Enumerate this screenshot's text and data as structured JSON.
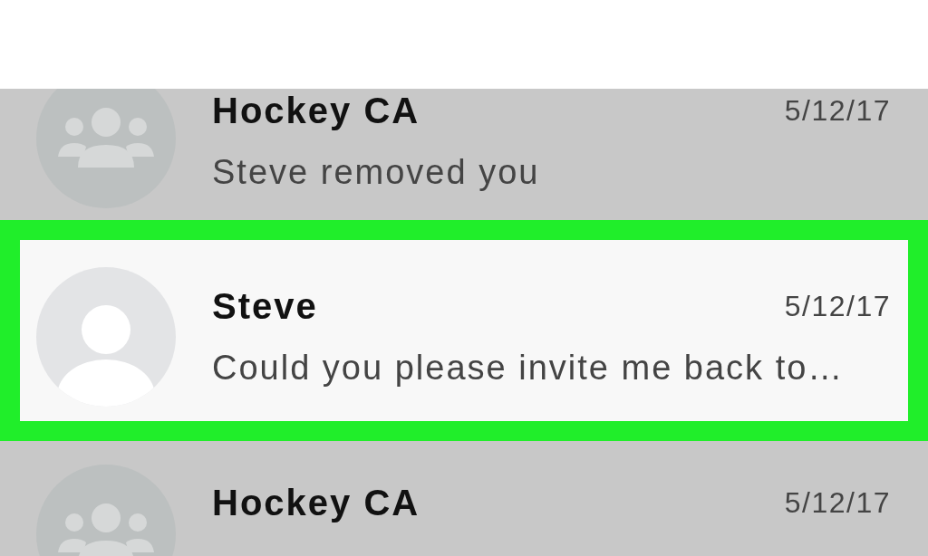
{
  "conversations": [
    {
      "kind": "group",
      "name": "Hockey CA",
      "date": "5/12/17",
      "preview": "Steve removed you",
      "selected": false
    },
    {
      "kind": "person",
      "name": "Steve",
      "date": "5/12/17",
      "preview": "Could you please invite me back to…",
      "selected": true
    },
    {
      "kind": "group",
      "name": "Hockey CA",
      "date": "5/12/17",
      "selected": false
    }
  ]
}
